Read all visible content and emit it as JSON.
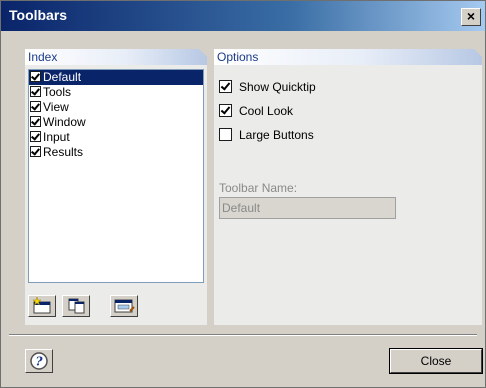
{
  "window": {
    "title": "Toolbars",
    "close_glyph": "×"
  },
  "index": {
    "header": "Index",
    "items": [
      {
        "label": "Default",
        "checked": true,
        "selected": true
      },
      {
        "label": "Tools",
        "checked": true,
        "selected": false
      },
      {
        "label": "View",
        "checked": true,
        "selected": false
      },
      {
        "label": "Window",
        "checked": true,
        "selected": false
      },
      {
        "label": "Input",
        "checked": true,
        "selected": false
      },
      {
        "label": "Results",
        "checked": true,
        "selected": false
      }
    ],
    "buttons": [
      {
        "name": "new-toolbar-icon"
      },
      {
        "name": "copy-toolbar-icon"
      },
      {
        "name": "customize-toolbar-icon"
      }
    ]
  },
  "options": {
    "header": "Options",
    "show_quicktip": {
      "label": "Show Quicktip",
      "checked": true
    },
    "cool_look": {
      "label": "Cool Look",
      "checked": true
    },
    "large_buttons": {
      "label": "Large Buttons",
      "checked": false
    },
    "toolbar_name_label": "Toolbar Name:",
    "toolbar_name_value": "Default"
  },
  "footer": {
    "help_icon": "help-icon",
    "close_label": "Close"
  }
}
